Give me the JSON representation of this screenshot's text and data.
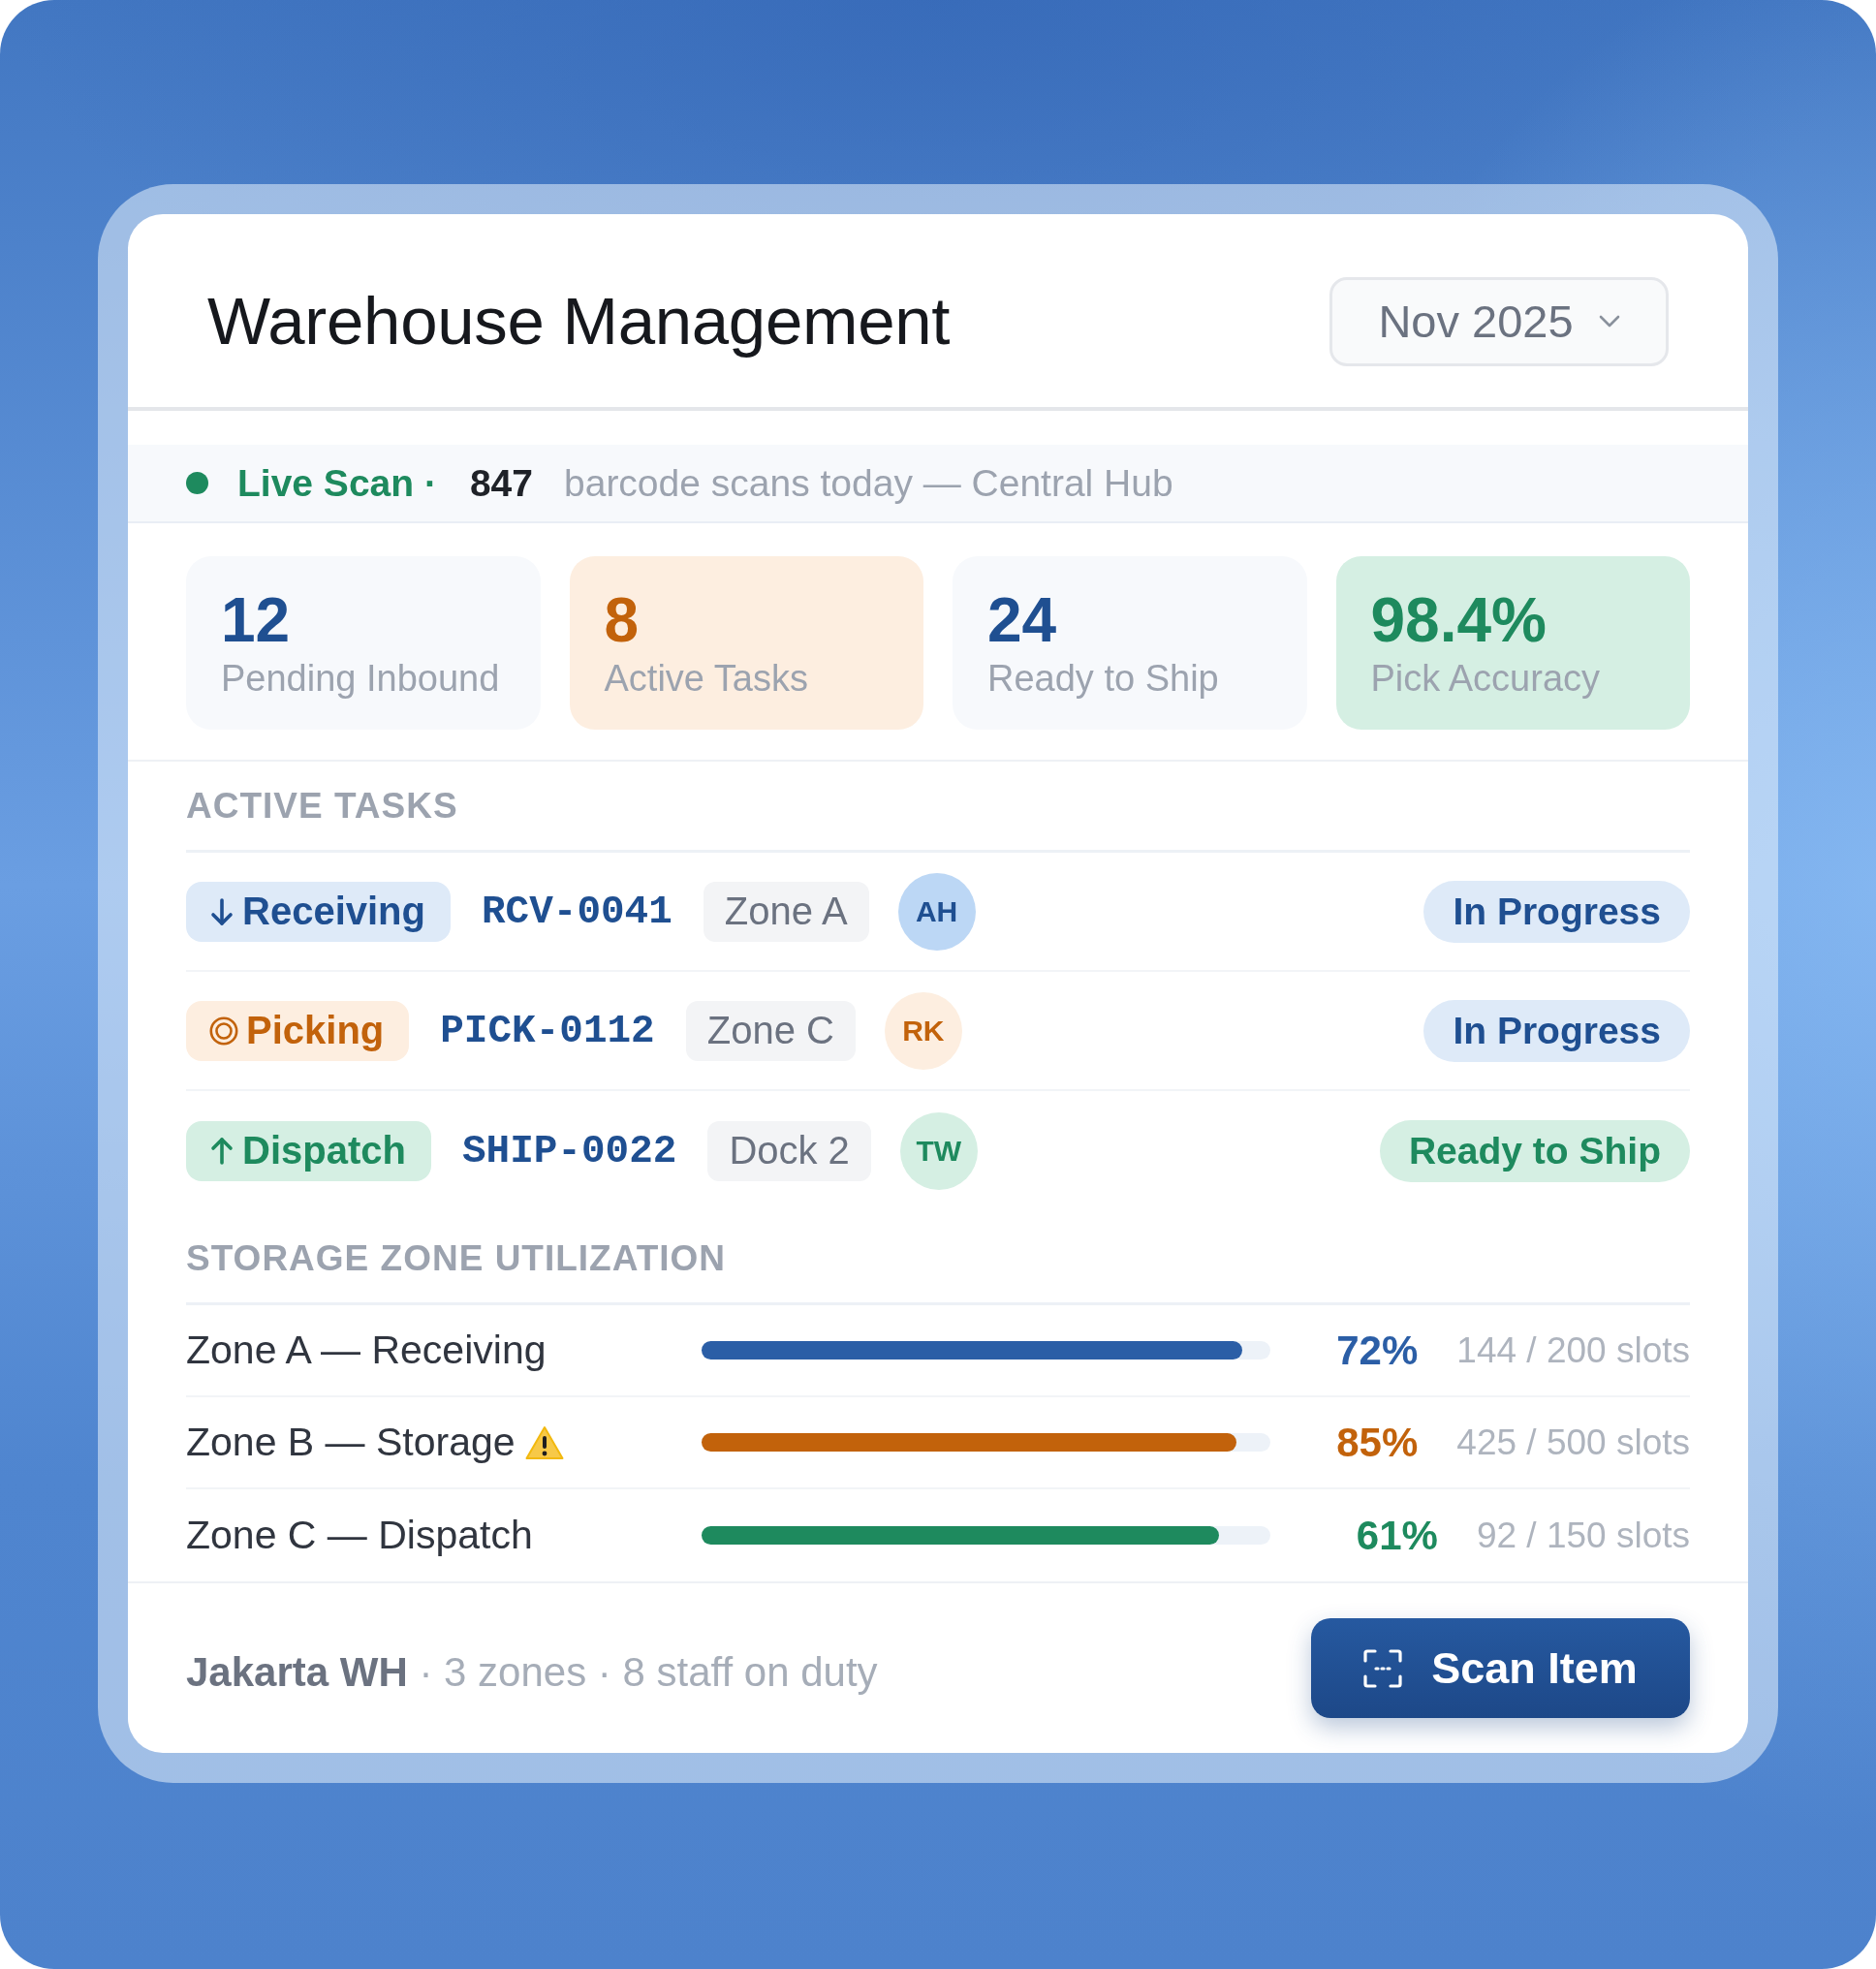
{
  "header": {
    "title": "Warehouse Management",
    "period": "Nov 2025"
  },
  "live_scan": {
    "label": "Live Scan ·",
    "count": "847",
    "text": "barcode scans today — Central Hub"
  },
  "stats": [
    {
      "value": "12",
      "label": "Pending Inbound",
      "kind": "neutral"
    },
    {
      "value": "8",
      "label": "Active Tasks",
      "kind": "warning"
    },
    {
      "value": "24",
      "label": "Ready to Ship",
      "kind": "neutral"
    },
    {
      "value": "98.4%",
      "label": "Pick Accuracy",
      "kind": "success"
    }
  ],
  "active_tasks": {
    "heading": "ACTIVE TASKS",
    "rows": [
      {
        "kind": "receiving",
        "category": "Receiving",
        "code": "RCV-0041",
        "location": "Zone A",
        "assignee": "AH",
        "status": {
          "label": "In Progress",
          "kind": "progress"
        }
      },
      {
        "kind": "picking",
        "category": "Picking",
        "code": "PICK-0112",
        "location": "Zone C",
        "assignee": "RK",
        "status": {
          "label": "In Progress",
          "kind": "progress"
        }
      },
      {
        "kind": "dispatch",
        "category": "Dispatch",
        "code": "SHIP-0022",
        "location": "Dock 2",
        "assignee": "TW",
        "status": {
          "label": "Ready to Ship",
          "kind": "ready"
        }
      }
    ]
  },
  "storage_zones": {
    "heading": "STORAGE ZONE UTILIZATION",
    "rows": [
      {
        "name": "Zone A — Receiving",
        "warning": false,
        "color": "#2b5ea6",
        "level": 0.95,
        "percent": "72%",
        "slots": "144 / 200 slots"
      },
      {
        "name": "Zone B — Storage",
        "warning": true,
        "color": "#c2620b",
        "level": 0.94,
        "percent": "85%",
        "slots": "425 / 500 slots"
      },
      {
        "name": "Zone C — Dispatch",
        "warning": false,
        "color": "#1e8a5e",
        "level": 0.91,
        "percent": "61%",
        "slots": "92 / 150 slots"
      }
    ]
  },
  "footer": {
    "summary": "**Jakarta WH** · 3 zones · 8 staff on duty",
    "button": "Scan Item"
  }
}
